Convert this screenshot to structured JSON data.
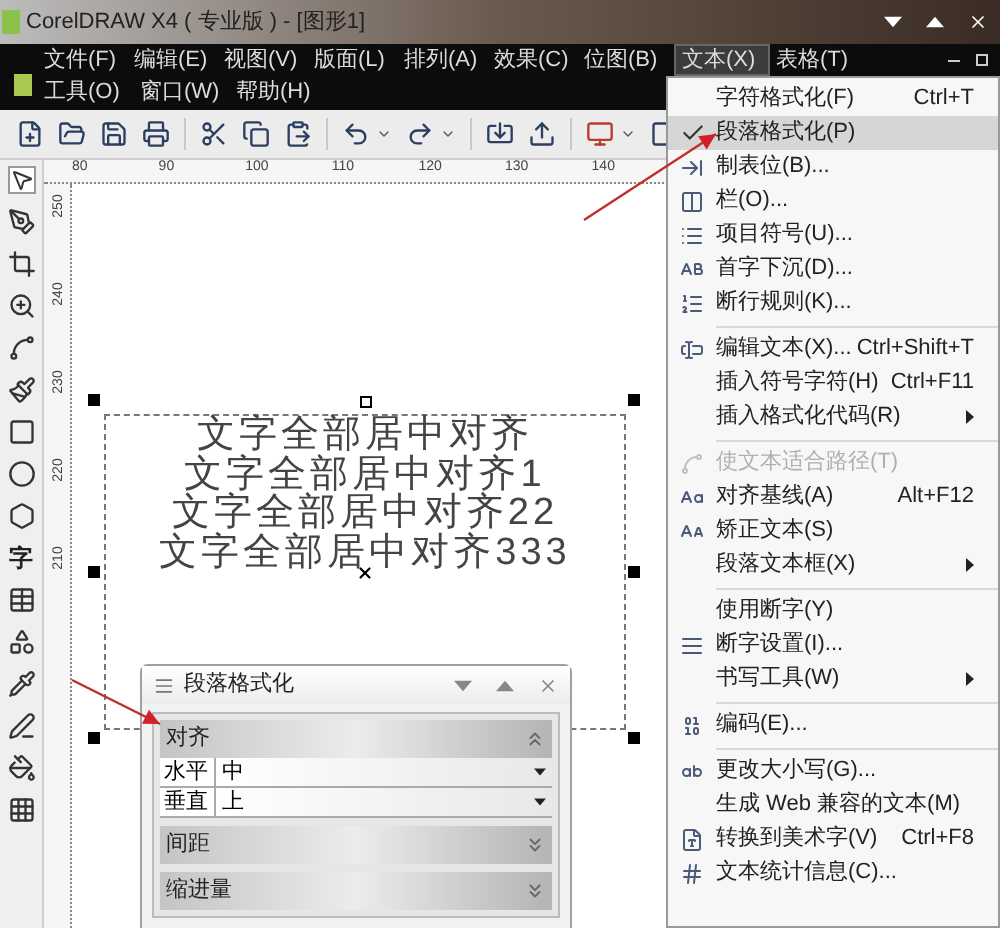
{
  "window": {
    "title": "CorelDRAW X4 ( 专业版 ) - [图形1]"
  },
  "menu_bar": {
    "row_1": [
      "文件(F)",
      "编辑(E)",
      "视图(V)",
      "版面(L)",
      "排列(A)",
      "效果(C)",
      "位图(B)"
    ],
    "row_2": [
      "工具(O)",
      "窗口(W)",
      "帮助(H)"
    ]
  },
  "open_menus": [
    {
      "label": "文本(X)",
      "selected": true
    },
    {
      "label": "表格(T)",
      "selected": false
    }
  ],
  "text_menu": [
    {
      "kind": "item",
      "label": "字符格式化(F)",
      "shortcut": "Ctrl+T",
      "checked": false,
      "selected": false,
      "disabled": false,
      "submenu": false
    },
    {
      "kind": "item",
      "label": "段落格式化(P)",
      "checked": true,
      "selected": true,
      "disabled": false,
      "submenu": false
    },
    {
      "kind": "item",
      "label": "制表位(B)...",
      "checked": false,
      "selected": false,
      "disabled": false,
      "submenu": false
    },
    {
      "kind": "item",
      "label": "栏(O)...",
      "checked": false,
      "selected": false,
      "disabled": false,
      "submenu": false
    },
    {
      "kind": "item",
      "label": "项目符号(U)...",
      "checked": false,
      "selected": false,
      "disabled": false,
      "submenu": false
    },
    {
      "kind": "item",
      "label": "首字下沉(D)...",
      "checked": false,
      "selected": false,
      "disabled": false,
      "submenu": false
    },
    {
      "kind": "item",
      "label": "断行规则(K)...",
      "checked": false,
      "selected": false,
      "disabled": false,
      "submenu": false
    },
    {
      "kind": "separator"
    },
    {
      "kind": "item",
      "label": "编辑文本(X)...",
      "shortcut": "Ctrl+Shift+T",
      "checked": false,
      "selected": false,
      "disabled": false,
      "submenu": false
    },
    {
      "kind": "item",
      "label": "插入符号字符(H)",
      "shortcut": "Ctrl+F11",
      "checked": false,
      "selected": false,
      "disabled": false,
      "submenu": false
    },
    {
      "kind": "item",
      "label": "插入格式化代码(R)",
      "checked": false,
      "selected": false,
      "disabled": false,
      "submenu": true
    },
    {
      "kind": "separator"
    },
    {
      "kind": "item",
      "label": "使文本适合路径(T)",
      "checked": false,
      "selected": false,
      "disabled": true,
      "submenu": false
    },
    {
      "kind": "item",
      "label": "对齐基线(A)",
      "shortcut": "Alt+F12",
      "checked": false,
      "selected": false,
      "disabled": false,
      "submenu": false
    },
    {
      "kind": "item",
      "label": "矫正文本(S)",
      "checked": false,
      "selected": false,
      "disabled": false,
      "submenu": false
    },
    {
      "kind": "item",
      "label": "段落文本框(X)",
      "checked": false,
      "selected": false,
      "disabled": false,
      "submenu": true
    },
    {
      "kind": "separator"
    },
    {
      "kind": "item",
      "label": "使用断字(Y)",
      "checked": false,
      "selected": false,
      "disabled": false,
      "submenu": false
    },
    {
      "kind": "item",
      "label": "断字设置(I)...",
      "checked": false,
      "selected": false,
      "disabled": false,
      "submenu": false
    },
    {
      "kind": "item",
      "label": "书写工具(W)",
      "checked": false,
      "selected": false,
      "disabled": false,
      "submenu": true
    },
    {
      "kind": "separator"
    },
    {
      "kind": "item",
      "label": "编码(E)...",
      "checked": false,
      "selected": false,
      "disabled": false,
      "submenu": false
    },
    {
      "kind": "separator"
    },
    {
      "kind": "item",
      "label": "更改大小写(G)...",
      "checked": false,
      "selected": false,
      "disabled": false,
      "submenu": false
    },
    {
      "kind": "item",
      "label": "生成 Web 兼容的文本(M)",
      "checked": false,
      "selected": false,
      "disabled": false,
      "submenu": false
    },
    {
      "kind": "item",
      "label": "转换到美术字(V)",
      "shortcut": "Ctrl+F8",
      "checked": false,
      "selected": false,
      "disabled": false,
      "submenu": false
    },
    {
      "kind": "item",
      "label": "文本统计信息(C)...",
      "checked": false,
      "selected": false,
      "disabled": false,
      "submenu": false
    }
  ],
  "toolbox": {
    "text_tool": "字"
  },
  "rulers": {
    "horizontal": [
      "80",
      "90",
      "100",
      "110",
      "120",
      "130",
      "140"
    ],
    "vertical": [
      "250",
      "240",
      "230",
      "220",
      "210"
    ]
  },
  "canvas": {
    "text_lines": [
      "文字全部居中对齐",
      "文字全部居中对齐1",
      "文字全部居中对齐22",
      "文字全部居中对齐333"
    ]
  },
  "docker": {
    "title": "段落格式化",
    "sections": [
      {
        "label": "对齐",
        "expanded": true,
        "fields": [
          {
            "label": "水平",
            "value": "中"
          },
          {
            "label": "垂直",
            "value": "上"
          }
        ]
      },
      {
        "label": "间距",
        "expanded": false
      },
      {
        "label": "缩进量",
        "expanded": false
      }
    ]
  }
}
